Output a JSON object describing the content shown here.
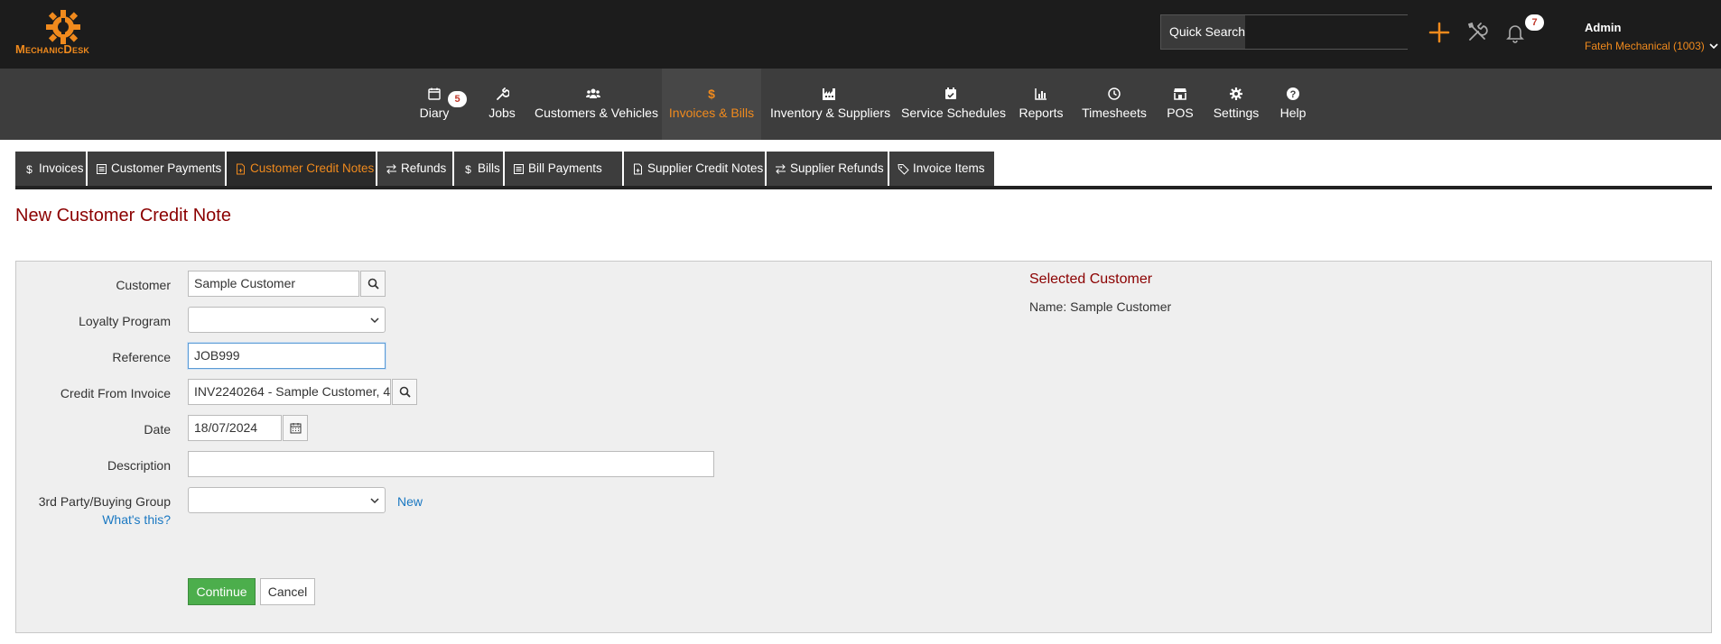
{
  "brand": {
    "logo_text": "MechanicDesk",
    "accent": "#f08a1d"
  },
  "header": {
    "quick_search_label": "Quick Search",
    "quick_search_value": "",
    "notification_count": "7",
    "user_name": "Admin",
    "user_company": "Fateh Mechanical (1003)"
  },
  "nav": {
    "diary_badge": "5",
    "items": [
      {
        "label": "Diary",
        "icon": "calendar-icon"
      },
      {
        "label": "Jobs",
        "icon": "wrench-icon"
      },
      {
        "label": "Customers & Vehicles",
        "icon": "users-icon"
      },
      {
        "label": "Invoices & Bills",
        "icon": "dollar-icon"
      },
      {
        "label": "Inventory & Suppliers",
        "icon": "warehouse-icon"
      },
      {
        "label": "Service Schedules",
        "icon": "calendar-check-icon"
      },
      {
        "label": "Reports",
        "icon": "chart-icon"
      },
      {
        "label": "Timesheets",
        "icon": "clock-icon"
      },
      {
        "label": "POS",
        "icon": "store-icon"
      },
      {
        "label": "Settings",
        "icon": "gear-icon"
      },
      {
        "label": "Help",
        "icon": "question-icon"
      }
    ],
    "active": "Invoices & Bills"
  },
  "subtabs": {
    "items": [
      {
        "label": "Invoices",
        "icon": "dollar-icon"
      },
      {
        "label": "Customer Payments",
        "icon": "receipt-icon"
      },
      {
        "label": "Customer Credit Notes",
        "icon": "file-icon"
      },
      {
        "label": "Refunds",
        "icon": "exchange-icon"
      },
      {
        "label": "Bills",
        "icon": "dollar-icon"
      },
      {
        "label": "Bill Payments",
        "icon": "receipt-icon"
      },
      {
        "label": "Supplier Credit Notes",
        "icon": "file-icon"
      },
      {
        "label": "Supplier Refunds",
        "icon": "exchange-icon"
      },
      {
        "label": "Invoice Items",
        "icon": "tags-icon"
      }
    ],
    "active": "Customer Credit Notes"
  },
  "page": {
    "title": "New Customer Credit Note"
  },
  "form": {
    "customer_label": "Customer",
    "customer_value": "Sample Customer",
    "loyalty_label": "Loyalty Program",
    "loyalty_value": "",
    "reference_label": "Reference",
    "reference_value": "JOB999",
    "invoice_label": "Credit From Invoice",
    "invoice_value": "INV2240264 - Sample Customer, 4",
    "date_label": "Date",
    "date_value": "18/07/2024",
    "description_label": "Description",
    "description_value": "",
    "third_party_label": "3rd Party/Buying Group",
    "third_party_value": "",
    "new_link": "New",
    "whats_this_link": "What's this?",
    "continue_label": "Continue",
    "cancel_label": "Cancel"
  },
  "selected_customer": {
    "title": "Selected Customer",
    "name_line": "Name: Sample Customer"
  }
}
